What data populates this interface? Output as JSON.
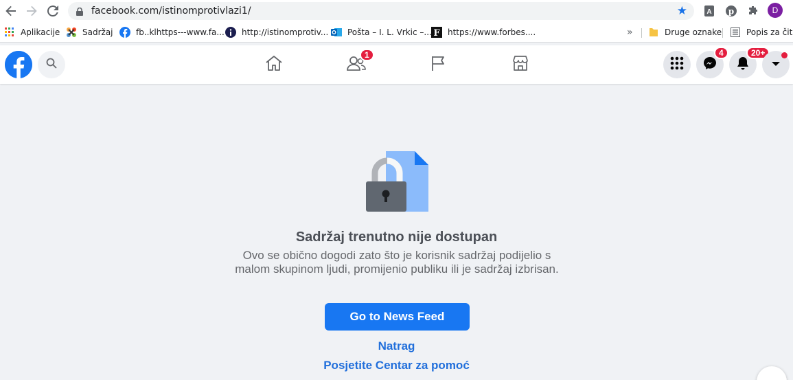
{
  "browser": {
    "url": "facebook.com/istinomprotivlazi1/",
    "profile_initial": "D"
  },
  "bookmarks": [
    {
      "label": "Aplikacije",
      "icon": "apps-grid-icon"
    },
    {
      "label": "Sadržaj",
      "icon": "joomla-icon"
    },
    {
      "label": "fb..klhttps---www.fa...",
      "icon": "facebook-icon"
    },
    {
      "label": "http://istinomprotiv...",
      "icon": "info-icon"
    },
    {
      "label": "Pošta – I. L. Vrkic –...",
      "icon": "outlook-icon"
    },
    {
      "label": "https://www.forbes....",
      "icon": "forbes-icon"
    }
  ],
  "bookmarks_overflow": "»",
  "bookmarks_folder": "Druge oznake",
  "reading_list": "Popis za čitar",
  "fb": {
    "friends_badge": "1",
    "messenger_badge": "4",
    "notifications_badge": "20+",
    "brand_color": "#1877f2",
    "badge_color": "#e41e3f"
  },
  "main": {
    "title": "Sadržaj trenutno nije dostupan",
    "description": "Ovo se obično dogodi zato što je korisnik sadržaj podijelio s malom skupinom ljudi, promijenio publiku ili je sadržaj izbrisan.",
    "cta": "Go to News Feed",
    "back_link": "Natrag",
    "help_link": "Posjetite Centar za pomoć"
  }
}
